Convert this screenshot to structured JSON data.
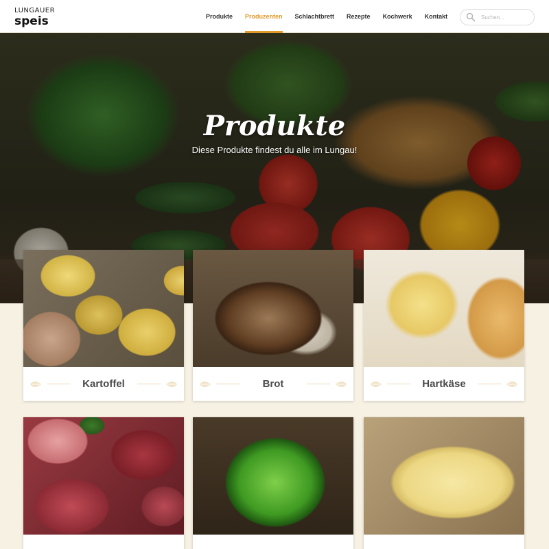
{
  "header": {
    "logo_top": "LUNGAUER",
    "logo_main": "speis",
    "nav": [
      {
        "label": "Produkte",
        "active": false
      },
      {
        "label": "Produzenten",
        "active": true
      },
      {
        "label": "Schlachtbrett",
        "active": false
      },
      {
        "label": "Rezepte",
        "active": false
      },
      {
        "label": "Kochwerk",
        "active": false
      },
      {
        "label": "Kontakt",
        "active": false
      }
    ],
    "search": {
      "placeholder": "Suchen...",
      "value": "",
      "icon": "search-icon"
    }
  },
  "hero": {
    "title": "Produkte",
    "subtitle": "Diese Produkte findest du alle im Lungau!"
  },
  "products": [
    {
      "label": "Kartoffel",
      "image": "potatoes"
    },
    {
      "label": "Brot",
      "image": "bread"
    },
    {
      "label": "Hartkäse",
      "image": "hard-cheese"
    },
    {
      "label": "",
      "image": "meat"
    },
    {
      "label": "",
      "image": "lettuce"
    },
    {
      "label": "",
      "image": "butter"
    }
  ],
  "colors": {
    "accent": "#e09a2a",
    "page_background": "#f6f1e3",
    "card_label": "#4a4a4a",
    "leaf_decoration": "#e9d9b8"
  }
}
